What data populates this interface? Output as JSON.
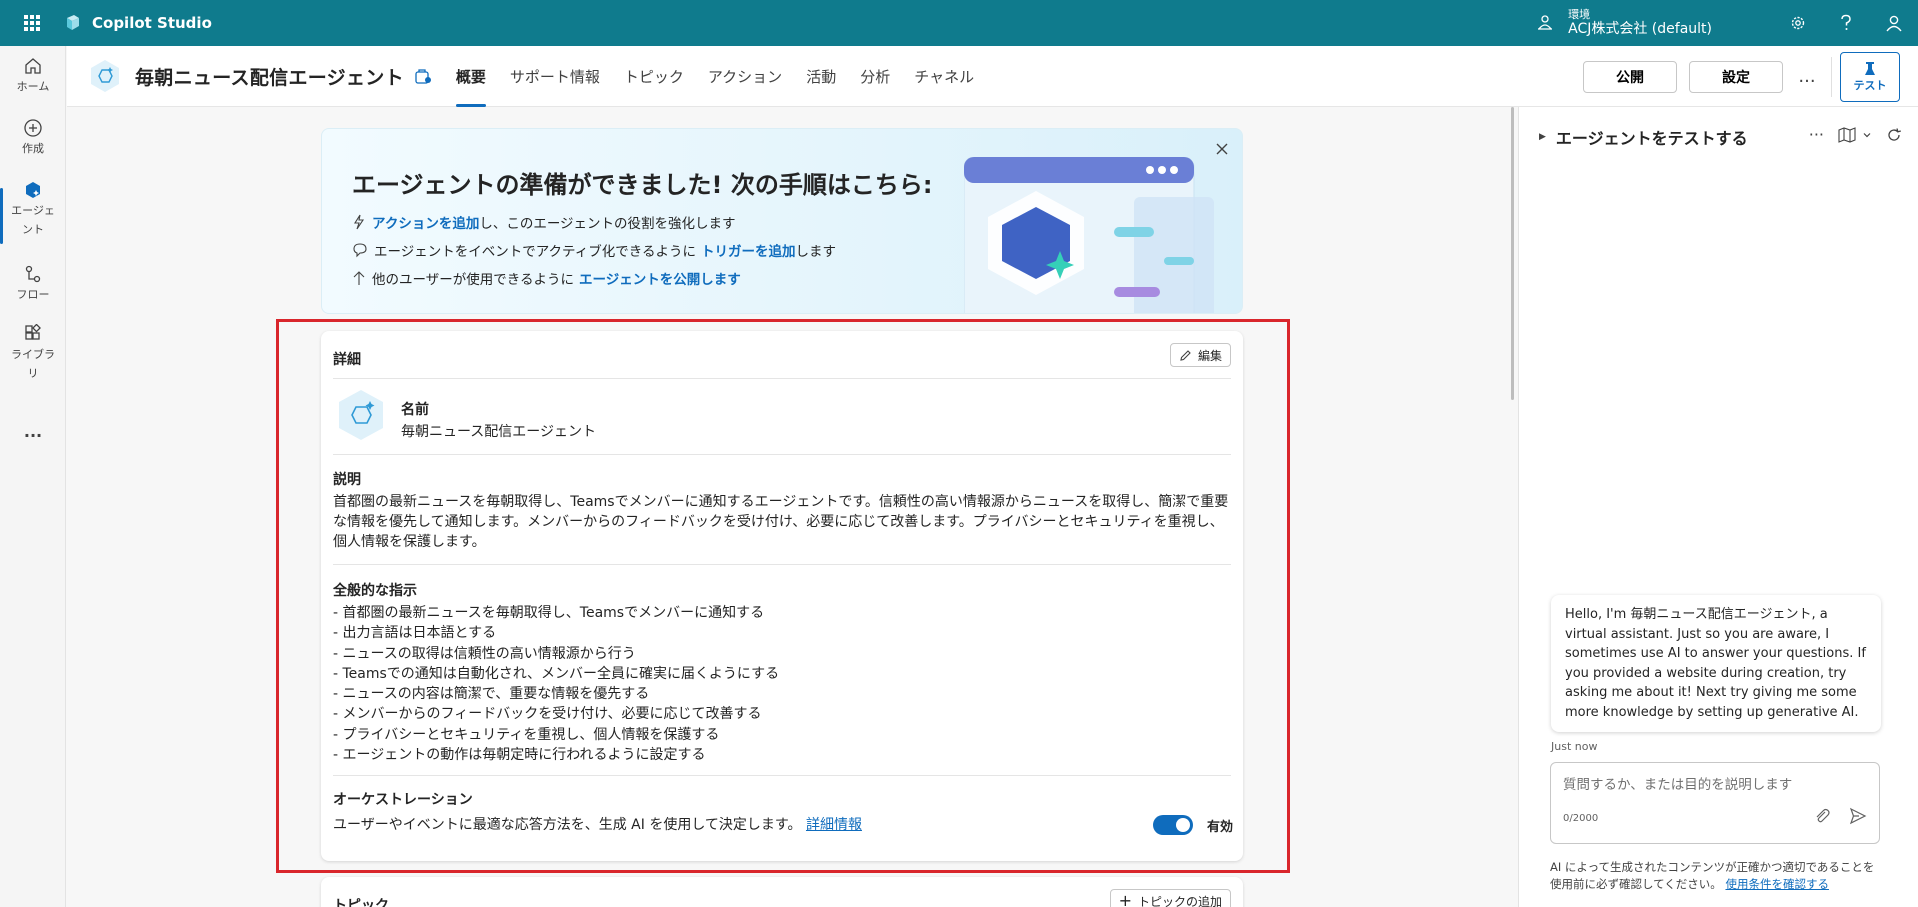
{
  "topbar": {
    "app_title": "Copilot Studio",
    "env_label": "環境",
    "env_name": "ACJ株式会社 (default)"
  },
  "rail": {
    "items": [
      {
        "label": "ホーム"
      },
      {
        "label": "作成"
      },
      {
        "label": "エージェント"
      },
      {
        "label": "フロー"
      },
      {
        "label": "ライブラリ"
      },
      {
        "label": "..."
      }
    ]
  },
  "header": {
    "agent_title": "毎朝ニュース配信エージェント",
    "tabs": [
      {
        "label": "概要"
      },
      {
        "label": "サポート情報"
      },
      {
        "label": "トピック"
      },
      {
        "label": "アクション"
      },
      {
        "label": "活動"
      },
      {
        "label": "分析"
      },
      {
        "label": "チャネル"
      }
    ],
    "publish_label": "公開",
    "settings_label": "設定",
    "more_label": "...",
    "test_label": "テスト"
  },
  "banner": {
    "title": "エージェントの準備ができました! 次の手順はこちら:",
    "line1_link": "アクションを追加",
    "line1_text": "し、このエージェントの役割を強化します",
    "line2_text": "エージェントをイベントでアクティブ化できるように",
    "line2_link": "トリガーを追加",
    "line2_suffix": "します",
    "line3_text": "他のユーザーが使用できるように",
    "line3_link": "エージェントを公開します"
  },
  "details": {
    "title": "詳細",
    "edit_label": "編集",
    "name_heading": "名前",
    "name_value": "毎朝ニュース配信エージェント",
    "desc_heading": "説明",
    "desc_text": "首都圏の最新ニュースを毎朝取得し、Teamsでメンバーに通知するエージェントです。信頼性の高い情報源からニュースを取得し、簡潔で重要な情報を優先して通知します。メンバーからのフィードバックを受け付け、必要に応じて改善します。プライバシーとセキュリティを重視し、個人情報を保護します。",
    "instr_heading": "全般的な指示",
    "instructions": [
      "- 首都圏の最新ニュースを毎朝取得し、Teamsでメンバーに通知する",
      "- 出力言語は日本語とする",
      "- ニュースの取得は信頼性の高い情報源から行う",
      "- Teamsでの通知は自動化され、メンバー全員に確実に届くようにする",
      "- ニュースの内容は簡潔で、重要な情報を優先する",
      "- メンバーからのフィードバックを受け付け、必要に応じて改善する",
      "- プライバシーとセキュリティを重視し、個人情報を保護する",
      "- エージェントの動作は毎朝定時に行われるように設定する"
    ],
    "orch_heading": "オーケストレーション",
    "orch_text": "ユーザーやイベントに最適な応答方法を、生成 AI を使用して決定します。",
    "orch_link": "詳細情報",
    "orch_toggle_label": "有効"
  },
  "topics_card": {
    "title": "トピック",
    "add_label": "トピックの追加"
  },
  "test_panel": {
    "title": "エージェントをテストする",
    "bubble_text": "Hello, I'm 毎朝ニュース配信エージェント, a virtual assistant. Just so you are aware, I sometimes use AI to answer your questions. If you provided a website during creation, try asking me about it! Next try giving me some more knowledge by setting up generative AI.",
    "timestamp": "Just now",
    "input_placeholder": "質問するか、または目的を説明します",
    "char_count": "0/2000",
    "disclaimer_text": "AI によって生成されたコンテンツが正確かつ適切であることを使用前に必ず確認してください。",
    "disclaimer_link": "使用条件を確認する"
  },
  "colors": {
    "topbar": "#0f7b8d",
    "accent": "#0f6cbd",
    "highlight": "#d9262c"
  }
}
